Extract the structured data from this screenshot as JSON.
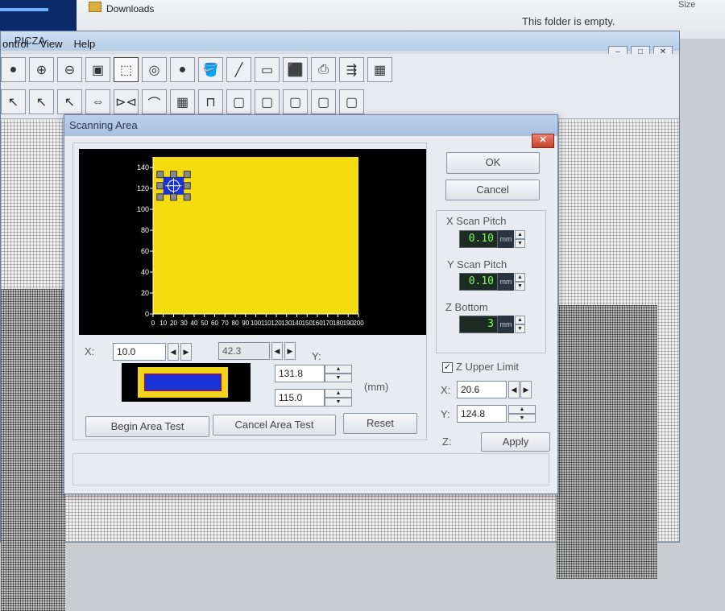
{
  "explorer": {
    "folder_name": "Downloads",
    "empty_message": "This folder is empty.",
    "size_header": "Size"
  },
  "app": {
    "title": "...PICZA",
    "menu": [
      "ontrol",
      "View",
      "Help"
    ],
    "window_buttons": [
      "–",
      "□",
      "✕"
    ]
  },
  "toolbar": {
    "row1": [
      "●",
      "⊕",
      "⊖",
      "▣",
      "⬚",
      "◎",
      "●",
      "🪣",
      "╱",
      "▭",
      "⬛",
      "⎙",
      "⇶",
      "▦"
    ],
    "row2": [
      "↖",
      "↖",
      "↖",
      "⇔",
      "⊳⊲",
      "⌒",
      "▦",
      "⊓",
      "▢",
      "▢",
      "▢",
      "▢",
      "▢"
    ]
  },
  "dialog": {
    "title": "Scanning Area",
    "ok_label": "OK",
    "cancel_label": "Cancel",
    "x_scan_pitch_label": "X Scan Pitch",
    "x_scan_pitch_value": "0.10",
    "y_scan_pitch_label": "Y Scan Pitch",
    "y_scan_pitch_value": "0.10",
    "z_bottom_label": "Z Bottom",
    "z_bottom_value": "3",
    "unit_mm": "mm",
    "z_upper_limit_label": "Z Upper Limit",
    "z_upper_limit_checked": true,
    "x_coord_label": "X:",
    "x_coord_value": "20.6",
    "y_coord_label": "Y:",
    "y_coord_value": "124.8",
    "apply_label": "Apply",
    "x_label": "X:",
    "x_value": "10.0",
    "y_label": "Y:",
    "y_value": "42.3",
    "width_value": "131.8",
    "height_value": "115.0",
    "mm_label": "(mm)",
    "begin_area_test_label": "Begin Area Test",
    "cancel_area_test_label": "Cancel Area Test",
    "reset_label": "Reset",
    "z_label": "Z:"
  },
  "chart_data": {
    "type": "scatter",
    "title": "",
    "xlabel": "",
    "ylabel": "",
    "xlim": [
      0,
      200
    ],
    "ylim": [
      0,
      150
    ],
    "x_ticks": [
      0,
      10,
      20,
      30,
      40,
      50,
      60,
      70,
      80,
      90,
      100,
      110,
      120,
      130,
      140,
      150,
      160,
      170,
      180,
      190,
      200
    ],
    "y_ticks": [
      0,
      20,
      40,
      60,
      80,
      100,
      120,
      140
    ],
    "bed_area": {
      "x": [
        0,
        200
      ],
      "y": [
        0,
        150
      ]
    },
    "selection": {
      "x": [
        10,
        30
      ],
      "y": [
        114,
        131
      ]
    },
    "colors": {
      "bed": "#f4dc10",
      "selection": "#1b33d6",
      "background": "#000000",
      "handles": "#8a8a8a"
    }
  }
}
